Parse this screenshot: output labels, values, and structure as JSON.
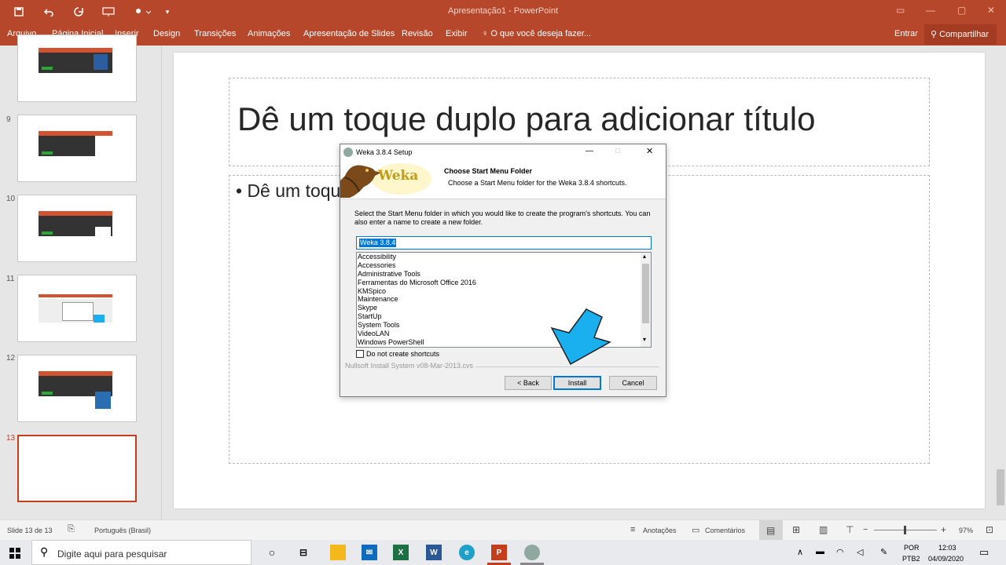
{
  "window": {
    "title": "Apresentação1 - PowerPoint"
  },
  "quick_access": {
    "save": "save-icon",
    "undo": "undo-icon",
    "redo": "redo-icon"
  },
  "ribbon": {
    "tabs": [
      "Arquivo",
      "Página Inicial",
      "Inserir",
      "Design",
      "Transições",
      "Animações",
      "Apresentação de Slides",
      "Revisão",
      "Exibir"
    ],
    "tell_me": "O que você deseja fazer...",
    "signin": "Entrar",
    "share": "Compartilhar"
  },
  "thumbnails": {
    "numbers": [
      "9",
      "10",
      "11",
      "12",
      "13"
    ],
    "active": "13"
  },
  "slide": {
    "title_placeholder": "Dê um toque duplo para adicionar título",
    "bullet_placeholder": "• Dê um toque duplo para adicionar texto"
  },
  "dialog": {
    "title": "Weka 3.8.4 Setup",
    "logo_text": "Weka",
    "header_title": "Choose Start Menu Folder",
    "header_subtitle": "Choose a Start Menu folder for the Weka 3.8.4 shortcuts.",
    "instruction": "Select the Start Menu folder in which you would like to create the program's shortcuts. You can also enter a name to create a new folder.",
    "folder_value": "Weka 3.8.4",
    "folders": [
      "Accessibility",
      "Accessories",
      "Administrative Tools",
      "Ferramentas do Microsoft Office 2016",
      "KMSpico",
      "Maintenance",
      "Skype",
      "StartUp",
      "System Tools",
      "VideoLAN",
      "Windows PowerShell"
    ],
    "checkbox_label": "Do not create shortcuts",
    "nsis_label": "Nullsoft Install System v08-Mar-2013.cvs",
    "back_label": "< Back",
    "install_label": "Install",
    "cancel_label": "Cancel"
  },
  "statusbar": {
    "slide_info": "Slide 13 de 13",
    "language": "Português (Brasil)",
    "notes": "Anotações",
    "comments": "Comentários",
    "zoom": "97%"
  },
  "taskbar": {
    "search_placeholder": "Digite aqui para pesquisar",
    "language_top": "POR",
    "language_bottom": "PTB2",
    "time": "12:03",
    "date": "04/09/2020"
  },
  "colors": {
    "accent": "#b7472a",
    "arrow": "#1ab0ef"
  }
}
